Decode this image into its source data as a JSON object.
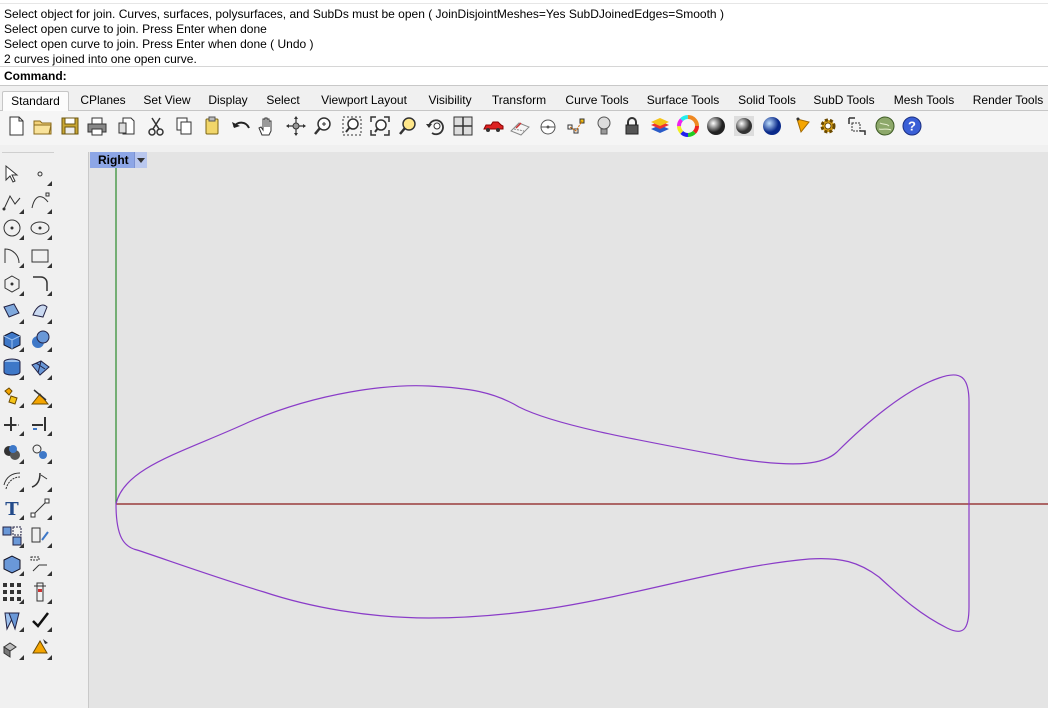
{
  "command_history": {
    "top_fragment": "",
    "lines": [
      "Select object for join. Curves, surfaces, polysurfaces, and SubDs must be open ( JoinDisjointMeshes=Yes  SubDJoinedEdges=Smooth )",
      "Select open curve to join. Press Enter when done",
      "Select open curve to join. Press Enter when done ( Undo )",
      "2 curves joined into one open curve."
    ]
  },
  "command_prompt": {
    "label": "Command:",
    "value": ""
  },
  "tabs": [
    {
      "label": "Standard",
      "active": true
    },
    {
      "label": "CPlanes"
    },
    {
      "label": "Set View"
    },
    {
      "label": "Display"
    },
    {
      "label": "Select"
    },
    {
      "label": "Viewport Layout"
    },
    {
      "label": "Visibility"
    },
    {
      "label": "Transform"
    },
    {
      "label": "Curve Tools"
    },
    {
      "label": "Surface Tools"
    },
    {
      "label": "Solid Tools"
    },
    {
      "label": "SubD Tools"
    },
    {
      "label": "Mesh Tools"
    },
    {
      "label": "Render Tools"
    }
  ],
  "toolbar_icons": [
    "new-file-icon",
    "open-folder-icon",
    "save-icon",
    "print-icon",
    "import-icon",
    "cut-icon",
    "copy-icon",
    "paste-icon",
    "undo-icon",
    "pan-hand-icon",
    "rotate-view-icon",
    "zoom-icon",
    "zoom-window-icon",
    "zoom-extents-icon",
    "zoom-selected-icon",
    "undo-view-icon",
    "four-viewports-icon",
    "car-icon",
    "cplane-icon",
    "grid-snap-icon",
    "select-points-icon",
    "light-bulb-icon",
    "lock-icon",
    "layer-icon",
    "color-wheel-icon",
    "material-sphere-icon",
    "rendered-sphere-icon",
    "render-sphere-icon",
    "lights-icon",
    "options-gear-icon",
    "selection-filter-icon",
    "globe-icon",
    "help-icon"
  ],
  "left_toolbar_icons": [
    "select-arrow-icon",
    "point-icon",
    "polyline-icon",
    "curve-icon",
    "circle-icon",
    "ellipse-icon",
    "arc-icon",
    "rectangle-icon",
    "polygon-icon",
    "fillet-curve-icon",
    "surface-from-curves-icon",
    "loft-surface-icon",
    "box-icon",
    "sphere-icon",
    "cylinder-icon",
    "mesh-icon",
    "explode-icon",
    "split-icon",
    "trim-icon",
    "extend-icon",
    "boolean-union-icon",
    "boolean-split-icon",
    "offset-curve-icon",
    "fillet-edge-icon",
    "text-icon",
    "dimension-icon",
    "array-icon",
    "group-icon",
    "block-icon",
    "curve-from-object-icon",
    "grid-array-icon",
    "analyze-icon",
    "transform-icon",
    "check-icon",
    "render-shapes-icon",
    "render-icon"
  ],
  "viewport": {
    "title": "Right",
    "curve_color": "#8a3cc8",
    "x_axis_color": "#8b1a1a",
    "y_axis_color": "#2a8a2a",
    "background": "#e4e4e4"
  }
}
